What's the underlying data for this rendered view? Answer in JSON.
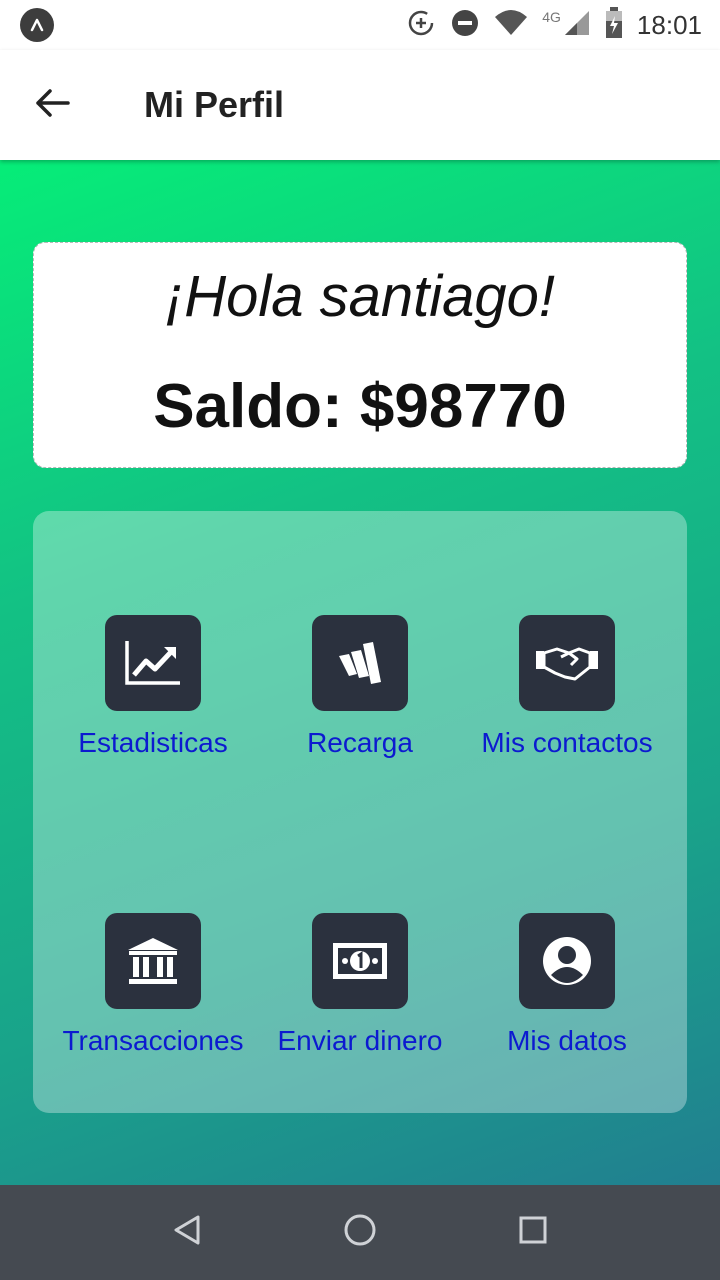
{
  "status_bar": {
    "time": "18:01",
    "network": "4G",
    "icons": [
      "app-notification-icon",
      "data-saver-icon",
      "do-not-disturb-icon",
      "wifi-icon",
      "cell-signal-icon",
      "battery-charging-icon"
    ]
  },
  "app_bar": {
    "title": "Mi Perfil",
    "back_icon": "arrow-left-icon"
  },
  "greeting_card": {
    "greeting": "¡Hola santiago!",
    "balance": "Saldo: $98770"
  },
  "menu": {
    "items": [
      {
        "label": "Estadisticas",
        "icon": "chart-line-icon"
      },
      {
        "label": "Recarga",
        "icon": "recharge-logo-icon"
      },
      {
        "label": "Mis contactos",
        "icon": "handshake-icon"
      },
      {
        "label": "Transacciones",
        "icon": "bank-icon"
      },
      {
        "label": "Enviar dinero",
        "icon": "money-bill-icon"
      },
      {
        "label": "Mis datos",
        "icon": "user-circle-icon"
      }
    ]
  },
  "nav_bar": {
    "buttons": [
      "back-triangle-icon",
      "home-circle-icon",
      "recents-square-icon"
    ]
  },
  "colors": {
    "gradient_top": "#06ed78",
    "gradient_bottom": "#217f90",
    "icon_tile": "#2b313e",
    "menu_label": "#0c1ad0",
    "nav_bar": "#454a51"
  }
}
